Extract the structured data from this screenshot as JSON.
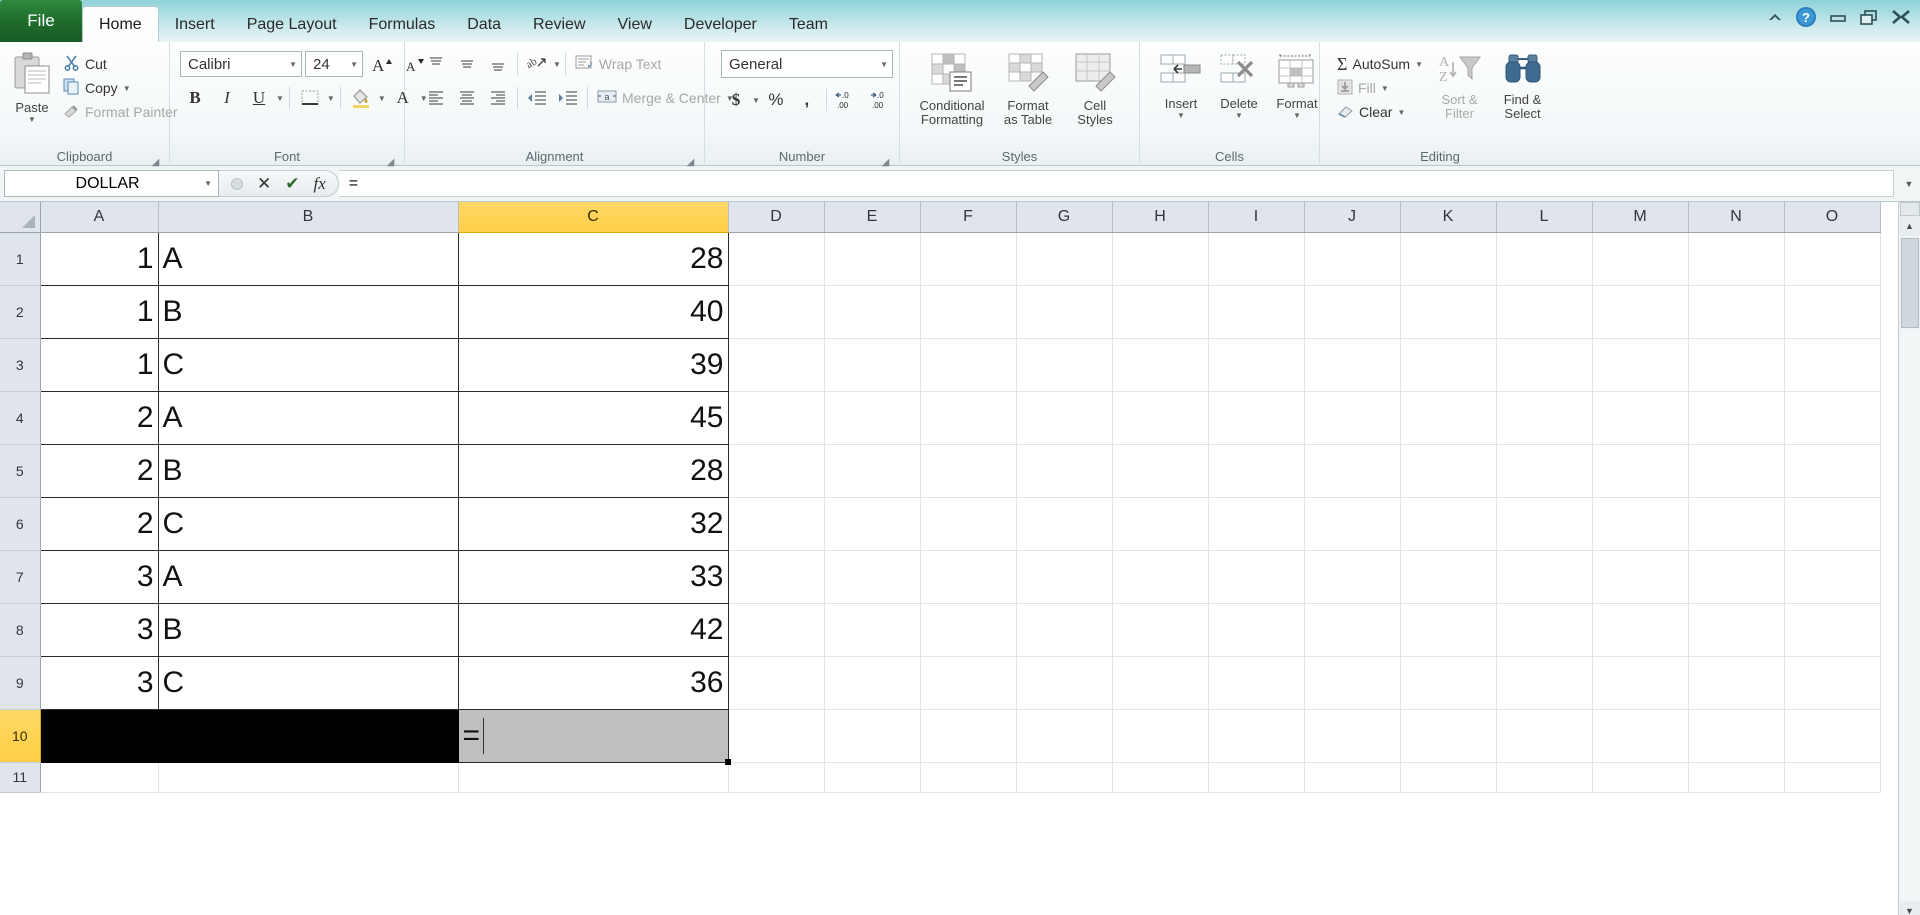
{
  "window": {
    "controls": [
      {
        "name": "collapse-ribbon",
        "glyph": "⌃"
      },
      {
        "name": "help",
        "glyph": "?"
      },
      {
        "name": "minimize",
        "glyph": "–"
      },
      {
        "name": "restore",
        "glyph": "❐"
      },
      {
        "name": "close",
        "glyph": "✕"
      }
    ]
  },
  "tabs": {
    "file": "File",
    "items": [
      "Home",
      "Insert",
      "Page Layout",
      "Formulas",
      "Data",
      "Review",
      "View",
      "Developer",
      "Team"
    ],
    "active": "Home"
  },
  "ribbon": {
    "clipboard": {
      "label": "Clipboard",
      "paste": "Paste",
      "cut": "Cut",
      "copy": "Copy",
      "format_painter": "Format Painter"
    },
    "font": {
      "label": "Font",
      "font_name": "Calibri",
      "font_size": "24",
      "grow": "A",
      "shrink": "A",
      "bold": "B",
      "italic": "I",
      "underline": "U",
      "borders": "borders",
      "fill": "A",
      "color": "A"
    },
    "alignment": {
      "label": "Alignment",
      "wrap_text": "Wrap Text",
      "merge_center": "Merge & Center",
      "orientation": "orientation"
    },
    "number": {
      "label": "Number",
      "format": "General",
      "currency": "$",
      "percent": "%",
      "comma": ",",
      "inc_decimal": ".00",
      "dec_decimal": ".00"
    },
    "styles": {
      "label": "Styles",
      "conditional_formatting": "Conditional\nFormatting",
      "conditional_formatting_l1": "Conditional",
      "conditional_formatting_l2": "Formatting",
      "format_as_table_l1": "Format",
      "format_as_table_l2": "as Table",
      "cell_styles_l1": "Cell",
      "cell_styles_l2": "Styles"
    },
    "cells": {
      "label": "Cells",
      "insert": "Insert",
      "delete": "Delete",
      "format": "Format"
    },
    "editing": {
      "label": "Editing",
      "autosum": "AutoSum",
      "fill": "Fill",
      "clear": "Clear",
      "sort_filter_l1": "Sort &",
      "sort_filter_l2": "Filter",
      "find_select_l1": "Find &",
      "find_select_l2": "Select"
    }
  },
  "formula_bar": {
    "name_box": "DOLLAR",
    "cancel": "✕",
    "enter": "✔",
    "fx": "fx",
    "formula": "="
  },
  "sheet": {
    "columns": [
      "A",
      "B",
      "C",
      "D",
      "E",
      "F",
      "G",
      "H",
      "I",
      "J",
      "K",
      "L",
      "M",
      "N",
      "O"
    ],
    "selected_column": "C",
    "rows": [
      "1",
      "2",
      "3",
      "4",
      "5",
      "6",
      "7",
      "8",
      "9",
      "10",
      "11"
    ],
    "selected_row": "10",
    "active_cell": "C10",
    "active_cell_content": "=",
    "data": [
      {
        "row": "1",
        "a": "1",
        "b": "A",
        "c": "28"
      },
      {
        "row": "2",
        "a": "1",
        "b": "B",
        "c": "40"
      },
      {
        "row": "3",
        "a": "1",
        "b": "C",
        "c": "39"
      },
      {
        "row": "4",
        "a": "2",
        "b": "A",
        "c": "45"
      },
      {
        "row": "5",
        "a": "2",
        "b": "B",
        "c": "28"
      },
      {
        "row": "6",
        "a": "2",
        "b": "C",
        "c": "32"
      },
      {
        "row": "7",
        "a": "3",
        "b": "A",
        "c": "33"
      },
      {
        "row": "8",
        "a": "3",
        "b": "B",
        "c": "42"
      },
      {
        "row": "9",
        "a": "3",
        "b": "C",
        "c": "36"
      }
    ]
  },
  "colors": {
    "file_tab_green": "#1e6b2c",
    "titlebar_teal": "#a9dde1",
    "selected_header": "#ffcf46",
    "active_cell_fill": "#bfbfbf",
    "black_selection": "#000000"
  }
}
